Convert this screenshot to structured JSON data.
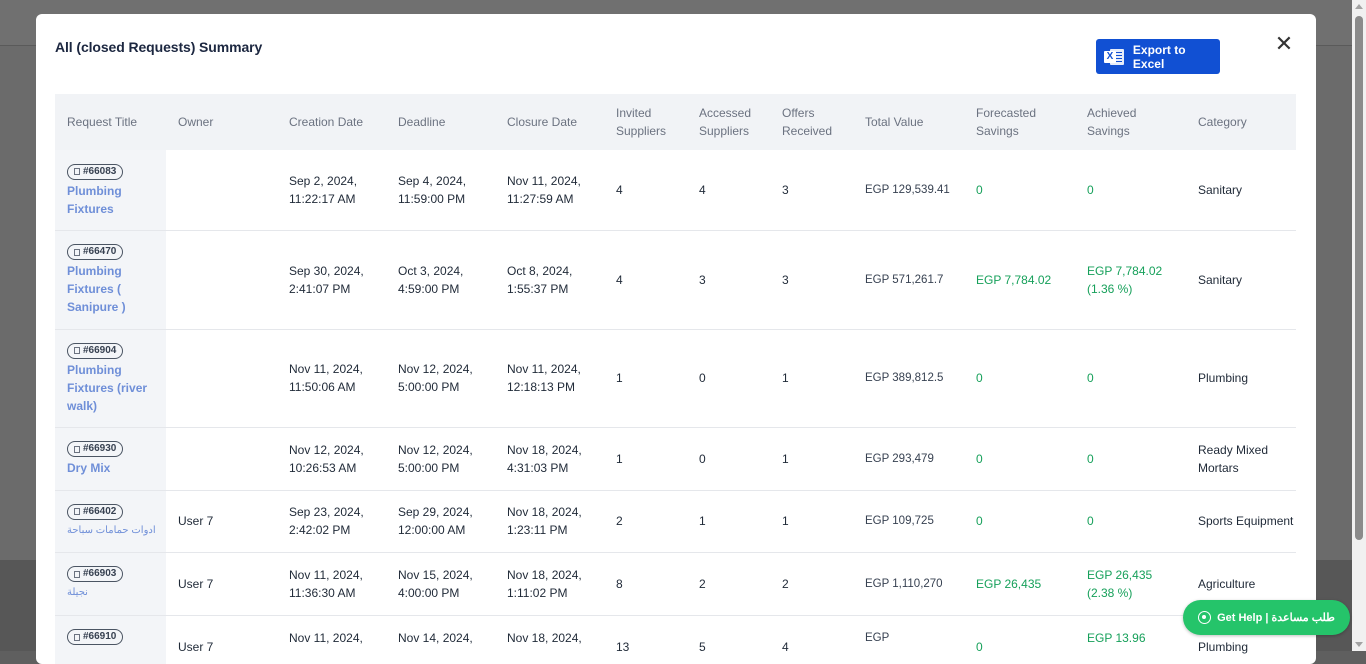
{
  "modal": {
    "title": "All (closed Requests) Summary",
    "export_label": "Export to Excel",
    "close_glyph": "✕"
  },
  "table": {
    "headers": {
      "request_title": "Request Title",
      "owner": "Owner",
      "creation_date": "Creation Date",
      "deadline": "Deadline",
      "closure_date": "Closure Date",
      "invited_suppliers_1": "Invited",
      "invited_suppliers_2": "Suppliers",
      "accessed_suppliers_1": "Accessed",
      "accessed_suppliers_2": "Suppliers",
      "offers_received_1": "Offers",
      "offers_received_2": "Received",
      "total_value": "Total Value",
      "forecasted_savings_1": "Forecasted",
      "forecasted_savings_2": "Savings",
      "achieved_savings_1": "Achieved",
      "achieved_savings_2": "Savings",
      "category": "Category"
    },
    "rows": [
      {
        "id": "#66083",
        "title": "Plumbing Fixtures",
        "owner": "",
        "created_1": "Sep 2, 2024,",
        "created_2": "11:22:17 AM",
        "deadline_1": "Sep 4, 2024,",
        "deadline_2": "11:59:00 PM",
        "closure_1": "Nov 11, 2024,",
        "closure_2": "11:27:59 AM",
        "invited": "4",
        "accessed": "4",
        "offers": "3",
        "total": "EGP 129,539.41",
        "forecast": "0",
        "achieved_1": "0",
        "achieved_2": "",
        "category": "Sanitary"
      },
      {
        "id": "#66470",
        "title": "Plumbing Fixtures ( Sanipure )",
        "owner": "",
        "created_1": "Sep 30, 2024,",
        "created_2": "2:41:07 PM",
        "deadline_1": "Oct 3, 2024,",
        "deadline_2": "4:59:00 PM",
        "closure_1": "Oct 8, 2024,",
        "closure_2": "1:55:37 PM",
        "invited": "4",
        "accessed": "3",
        "offers": "3",
        "total": "EGP 571,261.7",
        "forecast": "EGP 7,784.02",
        "achieved_1": "EGP 7,784.02",
        "achieved_2": "(1.36 %)",
        "category": "Sanitary"
      },
      {
        "id": "#66904",
        "title": "Plumbing Fixtures (river walk)",
        "owner": "",
        "created_1": "Nov 11, 2024,",
        "created_2": "11:50:06 AM",
        "deadline_1": "Nov 12, 2024,",
        "deadline_2": "5:00:00 PM",
        "closure_1": "Nov 11, 2024,",
        "closure_2": "12:18:13 PM",
        "invited": "1",
        "accessed": "0",
        "offers": "1",
        "total": "EGP 389,812.5",
        "forecast": "0",
        "achieved_1": "0",
        "achieved_2": "",
        "category": "Plumbing"
      },
      {
        "id": "#66930",
        "title": "Dry Mix",
        "owner": "",
        "created_1": "Nov 12, 2024,",
        "created_2": "10:26:53 AM",
        "deadline_1": "Nov 12, 2024,",
        "deadline_2": "5:00:00 PM",
        "closure_1": "Nov 18, 2024,",
        "closure_2": "4:31:03 PM",
        "invited": "1",
        "accessed": "0",
        "offers": "1",
        "total": "EGP 293,479",
        "forecast": "0",
        "achieved_1": "0",
        "achieved_2": "",
        "category": "Ready Mixed Mortars"
      },
      {
        "id": "#66402",
        "title": "ادوات حمامات سباحة",
        "owner": "User 7",
        "created_1": "Sep 23, 2024,",
        "created_2": "2:42:02 PM",
        "deadline_1": "Sep 29, 2024,",
        "deadline_2": "12:00:00 AM",
        "closure_1": "Nov 18, 2024,",
        "closure_2": "1:23:11 PM",
        "invited": "2",
        "accessed": "1",
        "offers": "1",
        "total": "EGP 109,725",
        "forecast": "0",
        "achieved_1": "0",
        "achieved_2": "",
        "category": "Sports Equipment"
      },
      {
        "id": "#66903",
        "title": "نجيلة",
        "owner": "User 7",
        "created_1": "Nov 11, 2024,",
        "created_2": "11:36:30 AM",
        "deadline_1": "Nov 15, 2024,",
        "deadline_2": "4:00:00 PM",
        "closure_1": "Nov 18, 2024,",
        "closure_2": "1:11:02 PM",
        "invited": "8",
        "accessed": "2",
        "offers": "2",
        "total": "EGP 1,110,270",
        "forecast": "EGP 26,435",
        "achieved_1": "EGP 26,435",
        "achieved_2": "(2.38 %)",
        "category": "Agriculture"
      },
      {
        "id": "#66910",
        "title": "",
        "owner": "User 7",
        "created_1": "Nov 11, 2024,",
        "created_2": "",
        "deadline_1": "Nov 14, 2024,",
        "deadline_2": "",
        "closure_1": "Nov 18, 2024,",
        "closure_2": "",
        "invited": "13",
        "accessed": "5",
        "offers": "4",
        "total": "EGP",
        "forecast": "0",
        "achieved_1": "EGP 13.96",
        "achieved_2": "",
        "category": "Plumbing"
      }
    ]
  },
  "help": {
    "label": "Get Help | طلب مساعدة"
  }
}
